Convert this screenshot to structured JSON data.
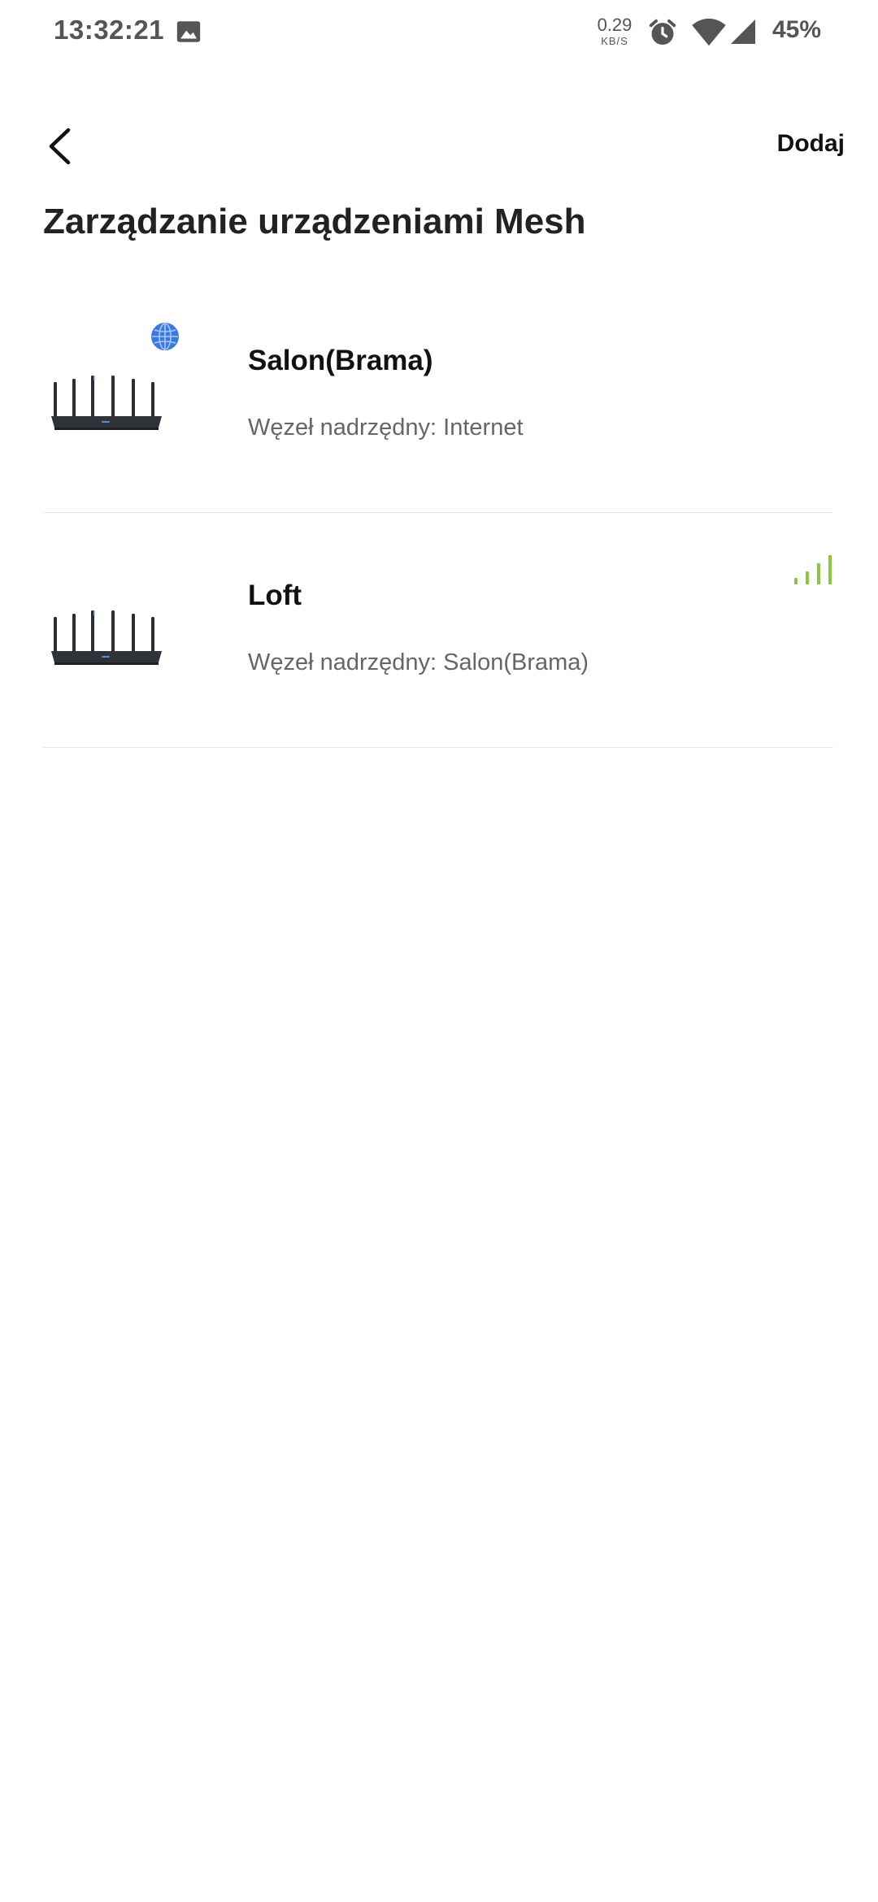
{
  "status_bar": {
    "time": "13:32:21",
    "speed_value": "0.29",
    "speed_unit": "KB/S",
    "battery": "45%",
    "icons": [
      "gallery-icon",
      "alarm-icon",
      "wifi-icon",
      "cell-signal-icon"
    ]
  },
  "header": {
    "back_icon": "chevron-left-icon",
    "add_label": "Dodaj",
    "title": "Zarządzanie urządzeniami Mesh"
  },
  "devices": [
    {
      "name": "Salon(Brama)",
      "parent": "Węzeł nadrzędny: Internet",
      "status_icon": "globe-icon"
    },
    {
      "name": "Loft",
      "parent": "Węzeł nadrzędny: Salon(Brama)",
      "status_icon": "signal-strength-icon",
      "signal_bars": 4,
      "signal_bars_max": 4
    }
  ],
  "colors": {
    "globe": "#3b7ae0",
    "signal": "#8dc63f",
    "divider": "#e8e8e8",
    "status_text": "#555555",
    "subtitle_text": "#666666"
  }
}
